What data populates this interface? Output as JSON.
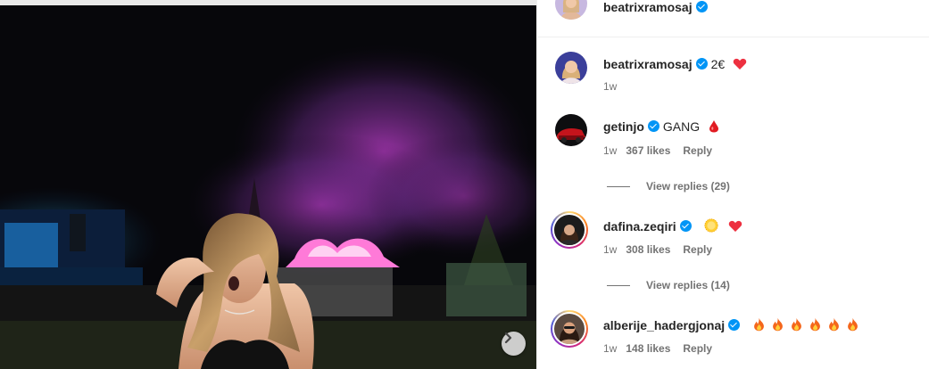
{
  "post": {
    "author": "beatrixramosaj",
    "author_verified": true
  },
  "comments": [
    {
      "username": "beatrixramosaj",
      "verified": true,
      "text": "2€",
      "emojis": [
        "red-heart"
      ],
      "age": "1w",
      "likes": "",
      "reply_label": "",
      "view_replies": ""
    },
    {
      "username": "getinjo",
      "verified": true,
      "text": "GANG",
      "emojis": [
        "drop-of-blood"
      ],
      "age": "1w",
      "likes": "367 likes",
      "reply_label": "Reply",
      "view_replies": "View replies (29)"
    },
    {
      "username": "dafina.zeqiri",
      "verified": true,
      "text": "",
      "emojis": [
        "sun",
        "red-heart"
      ],
      "age": "1w",
      "likes": "308 likes",
      "reply_label": "Reply",
      "view_replies": "View replies (14)"
    },
    {
      "username": "alberije_hadergjonaj",
      "verified": true,
      "text": "",
      "emojis": [
        "fire",
        "fire",
        "fire",
        "fire",
        "fire",
        "fire"
      ],
      "age": "1w",
      "likes": "148 likes",
      "reply_label": "Reply",
      "view_replies": ""
    }
  ],
  "media": {
    "next_icon": "chevron-right-icon"
  },
  "colors": {
    "verified_blue": "#0095f6",
    "meta_gray": "#737373",
    "heart_red": "#ed4956"
  }
}
